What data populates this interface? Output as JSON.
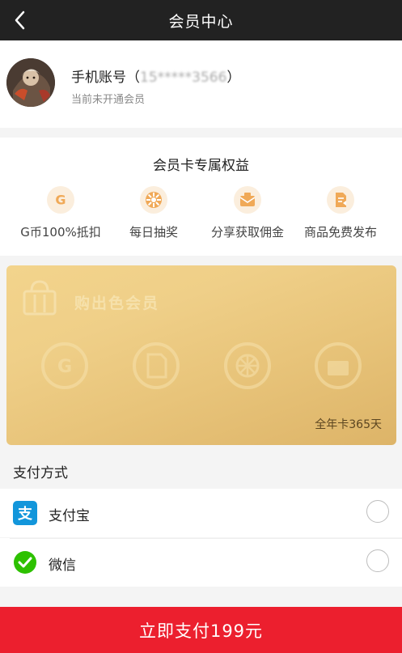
{
  "header": {
    "title": "会员中心",
    "back_icon": "chevron-left-icon"
  },
  "user": {
    "account_prefix": "手机账号",
    "account_open": "（",
    "account_masked": "15*****3566",
    "account_close": "）",
    "status": "当前未开通会员"
  },
  "benefits": {
    "title": "会员卡专属权益",
    "items": [
      {
        "label": "G币100%抵扣",
        "icon": "g-coin-icon"
      },
      {
        "label": "每日抽奖",
        "icon": "lottery-wheel-icon"
      },
      {
        "label": "分享获取佣金",
        "icon": "commission-envelope-icon"
      },
      {
        "label": "商品免费发布",
        "icon": "publish-document-icon"
      }
    ]
  },
  "card": {
    "title": "购出色会员",
    "duration": "全年卡365天"
  },
  "payment": {
    "title": "支付方式",
    "methods": [
      {
        "label": "支付宝",
        "icon": "alipay-icon",
        "color": "#1296db",
        "selected": false
      },
      {
        "label": "微信",
        "icon": "wechat-icon",
        "color": "#2dc100",
        "selected": false
      }
    ]
  },
  "pay_button": {
    "label": "立即支付199元"
  },
  "colors": {
    "header_bg": "#222222",
    "accent_red": "#ec1f2e",
    "gold": "#eccb84",
    "benefit_icon": "#f0a957"
  }
}
